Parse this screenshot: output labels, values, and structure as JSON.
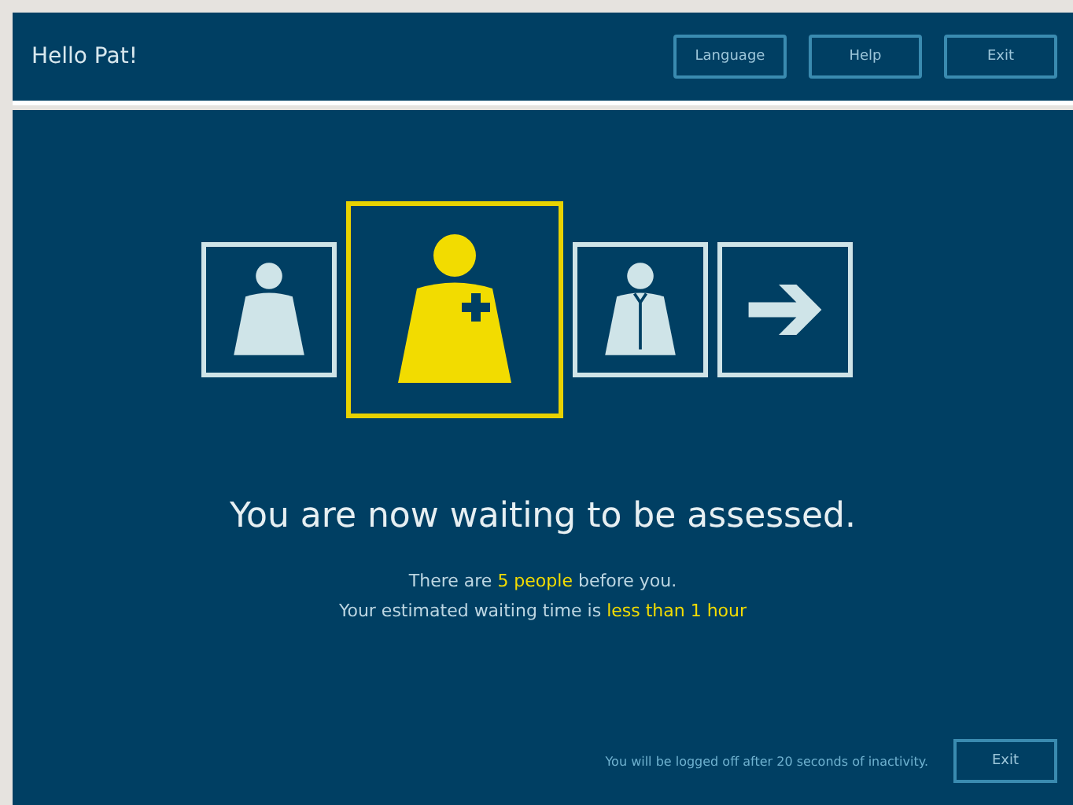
{
  "header": {
    "greeting": "Hello Pat!",
    "buttons": [
      "Language",
      "Help",
      "Exit"
    ]
  },
  "steps": [
    {
      "kind": "patient",
      "selected": false
    },
    {
      "kind": "nurse",
      "selected": true
    },
    {
      "kind": "doctor",
      "selected": false
    },
    {
      "kind": "arrow",
      "selected": false
    }
  ],
  "headline": "You are now waiting to be assessed.",
  "lines": [
    "There are **5 people** before you.",
    "Your estimated waiting time is **less than 1 hour**"
  ],
  "footer": {
    "notice": "You will be logged off after 20 seconds of inactivity.",
    "button": "Exit"
  }
}
